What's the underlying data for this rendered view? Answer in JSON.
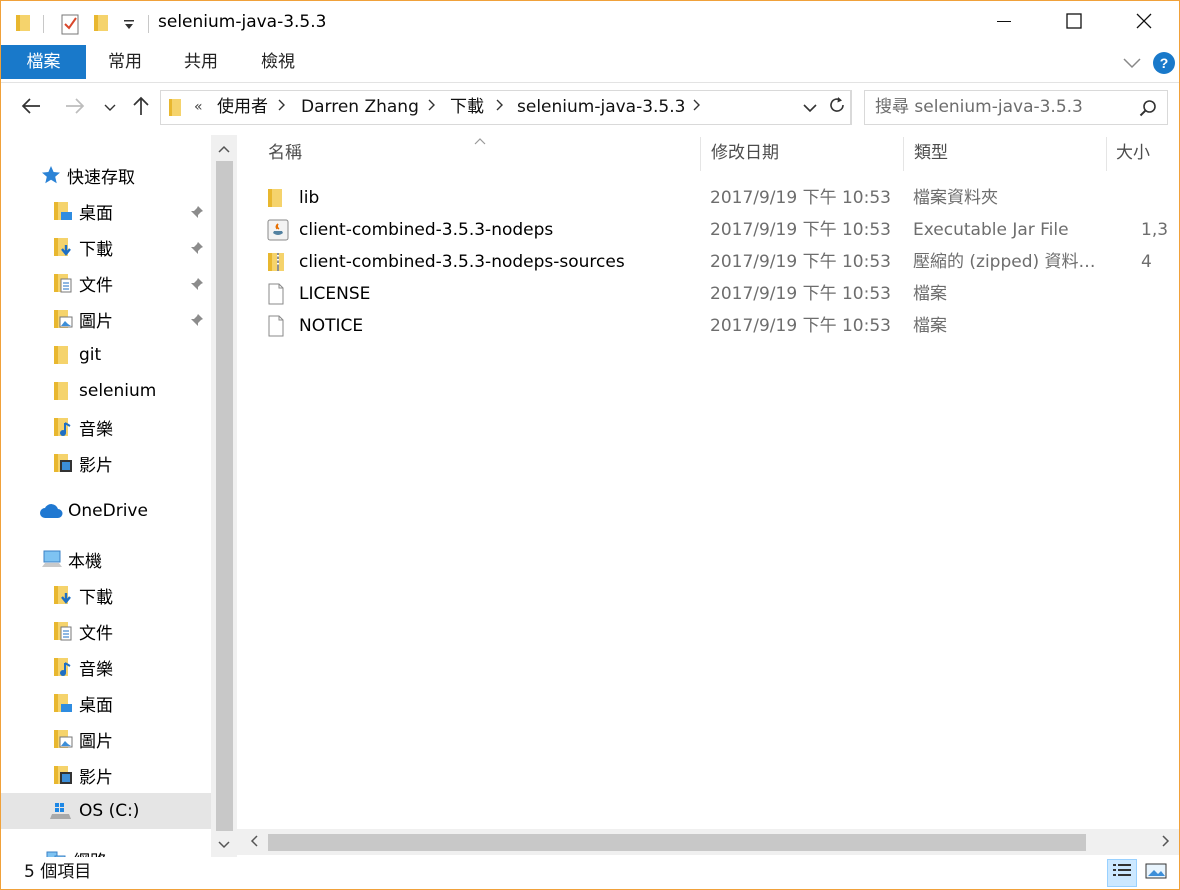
{
  "window": {
    "title": "selenium-java-3.5.3",
    "frame_color": "#f0a13a"
  },
  "ribbon": {
    "tabs": [
      {
        "label": "檔案",
        "active": true
      },
      {
        "label": "常用"
      },
      {
        "label": "共用"
      },
      {
        "label": "檢視"
      }
    ],
    "accent": "#1979ca",
    "help_label": "?"
  },
  "address": {
    "overflow": "«",
    "crumbs": [
      "使用者",
      "Darren Zhang",
      "下載",
      "selenium-java-3.5.3"
    ]
  },
  "search": {
    "placeholder": "搜尋 selenium-java-3.5.3"
  },
  "nav": {
    "quick_access": "快速存取",
    "quick_items": [
      {
        "label": "桌面",
        "icon": "desktop-folder-icon",
        "pinned": true
      },
      {
        "label": "下載",
        "icon": "downloads-folder-icon",
        "pinned": true
      },
      {
        "label": "文件",
        "icon": "documents-folder-icon",
        "pinned": true
      },
      {
        "label": "圖片",
        "icon": "pictures-folder-icon",
        "pinned": true
      },
      {
        "label": "git",
        "icon": "folder-icon",
        "pinned": false
      },
      {
        "label": "selenium",
        "icon": "folder-icon",
        "pinned": false
      },
      {
        "label": "音樂",
        "icon": "music-folder-icon",
        "pinned": false
      },
      {
        "label": "影片",
        "icon": "videos-folder-icon",
        "pinned": false
      }
    ],
    "onedrive": "OneDrive",
    "this_pc": "本機",
    "pc_items": [
      {
        "label": "下載",
        "icon": "downloads-folder-icon"
      },
      {
        "label": "文件",
        "icon": "documents-folder-icon"
      },
      {
        "label": "音樂",
        "icon": "music-folder-icon"
      },
      {
        "label": "桌面",
        "icon": "desktop-folder-icon"
      },
      {
        "label": "圖片",
        "icon": "pictures-folder-icon"
      },
      {
        "label": "影片",
        "icon": "videos-folder-icon"
      }
    ],
    "drive": "OS (C:)",
    "network": "網路"
  },
  "columns": {
    "name": "名稱",
    "date": "修改日期",
    "type": "類型",
    "size": "大小"
  },
  "files": [
    {
      "name": "lib",
      "date": "2017/9/19 下午 10:53",
      "type": "檔案資料夾",
      "size": "",
      "icon": "folder-icon"
    },
    {
      "name": "client-combined-3.5.3-nodeps",
      "date": "2017/9/19 下午 10:53",
      "type": "Executable Jar File",
      "size": "1,3",
      "icon": "java-jar-icon"
    },
    {
      "name": "client-combined-3.5.3-nodeps-sources",
      "date": "2017/9/19 下午 10:53",
      "type": "壓縮的 (zipped) 資料…",
      "size": "4",
      "icon": "zip-folder-icon"
    },
    {
      "name": "LICENSE",
      "date": "2017/9/19 下午 10:53",
      "type": "檔案",
      "size": "",
      "icon": "file-icon"
    },
    {
      "name": "NOTICE",
      "date": "2017/9/19 下午 10:53",
      "type": "檔案",
      "size": "",
      "icon": "file-icon"
    }
  ],
  "status": {
    "count": "5 個項目"
  }
}
